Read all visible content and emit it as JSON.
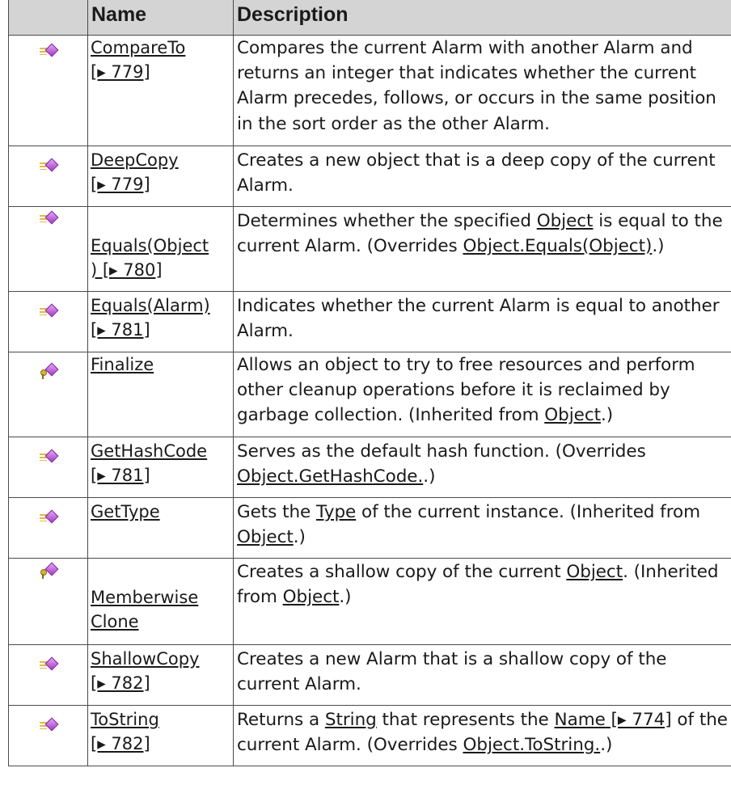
{
  "table": {
    "headers": {
      "icon": "",
      "name": "Name",
      "description": "Description"
    },
    "rows": [
      {
        "icon": "public-method-icon",
        "name_lines": [
          "CompareTo",
          "[▸ 779]"
        ],
        "desc_html": "Compares the current Alarm with another Alarm and returns an integer that indicates whether the current Alarm precedes, follows, or occurs in the same position in the sort order as the other Alarm."
      },
      {
        "icon": "public-method-icon",
        "name_lines": [
          "DeepCopy",
          "[▸ 779]"
        ],
        "desc_html": "Creates a new object that is a deep copy of the current Alarm."
      },
      {
        "icon": "public-method-icon",
        "name_lines": [
          "Equals(Object",
          ") [▸ 780]"
        ],
        "desc_html": "Determines whether the specified <u>Object</u> is equal to the current Alarm. (Overrides <u>Object.Equals(Object)</u>.)"
      },
      {
        "icon": "public-method-icon",
        "name_lines": [
          "Equals(Alarm)",
          "[▸ 781]"
        ],
        "desc_html": "Indicates whether the current Alarm is equal to another Alarm."
      },
      {
        "icon": "protected-method-icon",
        "name_lines": [
          "Finalize"
        ],
        "desc_html": "Allows an object to try to free resources and perform other cleanup operations before it is reclaimed by garbage collection. (Inherited from <u>Object</u>.)"
      },
      {
        "icon": "public-method-icon",
        "name_lines": [
          "GetHashCode",
          "[▸ 781]"
        ],
        "desc_html": "Serves as the default hash function. (Overrides <u>Object.GetHashCode.</u>.)"
      },
      {
        "icon": "public-method-icon",
        "name_lines": [
          "GetType"
        ],
        "desc_html": "Gets the <u>Type</u> of the current instance. (Inherited from <u>Object</u>.)"
      },
      {
        "icon": "protected-method-icon",
        "name_lines": [
          "Memberwise",
          "Clone"
        ],
        "desc_html": "Creates a shallow copy of the current <u>Object</u>. (Inherited from <u>Object</u>.)"
      },
      {
        "icon": "public-method-icon",
        "name_lines": [
          "ShallowCopy",
          "[▸ 782]"
        ],
        "desc_html": "Creates a new Alarm that is a shallow copy of the current Alarm."
      },
      {
        "icon": "public-method-icon",
        "name_lines": [
          "ToString",
          "[▸ 782]"
        ],
        "desc_html": "Returns a <u>String</u> that represents the <u>Name [▸ 774]</u> of the current Alarm. (Overrides <u>Object.ToString.</u>.)"
      }
    ]
  }
}
